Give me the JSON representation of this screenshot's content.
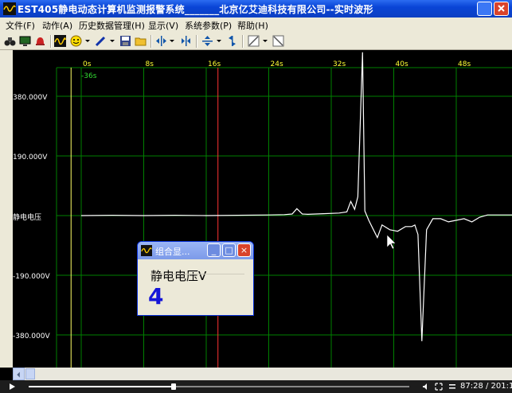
{
  "window": {
    "title": "EST405静电动态计算机监测报警系统_______北京亿艾迪科技有限公司--实时波形",
    "icon": "waveform-app-icon"
  },
  "menu": {
    "items": [
      "文件(F)",
      "动作(A)",
      "历史数据管理(H)",
      "显示(V)",
      "系统参数(P)",
      "帮助(H)"
    ]
  },
  "toolbar": {
    "icons": [
      "binoculars-icon",
      "monitor-icon",
      "alarm-bell-icon",
      "waveform-icon",
      "smiley-icon",
      "pen-icon",
      "save-disk-icon",
      "open-folder-icon",
      "zoom-in-x-icon",
      "zoom-out-x-icon",
      "zoom-in-y-icon",
      "fit-y-icon",
      "line-style-icon",
      "grid-toggle-icon"
    ]
  },
  "chart_data": {
    "type": "line",
    "x_tick_labels": [
      "0s",
      "8s",
      "16s",
      "24s",
      "32s",
      "40s",
      "48s"
    ],
    "x_offset_label": "-36s",
    "y_tick_labels": [
      "380.000V",
      "190.000V",
      "静电电压",
      "-190.000V",
      "-380.000V"
    ],
    "ylim": [
      -380,
      380
    ],
    "series": [
      {
        "name": "静电电压",
        "color": "#ffffff",
        "x": [
          0,
          4,
          8,
          12,
          16,
          20,
          24,
          26,
          27,
          27.6,
          28.3,
          29,
          31,
          33,
          34,
          34.5,
          35,
          35.4,
          36,
          36.3,
          36.8,
          37.3,
          37.9,
          38.5,
          39.5,
          40.5,
          41.5,
          42.3,
          42.7,
          43.1,
          43.6,
          44.2,
          45,
          46,
          47,
          48,
          49,
          50,
          51,
          52,
          55.5
        ],
        "y": [
          0,
          1,
          0,
          1,
          0,
          1,
          2,
          3,
          5,
          22,
          5,
          4,
          6,
          8,
          12,
          45,
          20,
          60,
          520,
          15,
          -15,
          -40,
          -70,
          -30,
          -45,
          -50,
          -35,
          -35,
          -30,
          -60,
          -400,
          -45,
          -10,
          -10,
          -20,
          -15,
          -10,
          -20,
          -5,
          2,
          2
        ]
      }
    ],
    "markers": [
      {
        "name": "yellow-cursor",
        "x": -1.3,
        "color": "#ffff66"
      },
      {
        "name": "red-cursor",
        "x": 17.5,
        "color": "#ff3333"
      }
    ],
    "grid": true
  },
  "dialog": {
    "title": "组合显...",
    "channel_label": "静电电压V",
    "value": "4",
    "buttons": [
      "_",
      "□",
      "×"
    ]
  },
  "statusbar": {
    "time": "87:28 / 201:1",
    "progress": 0.38
  },
  "colors": {
    "grid": "#008000",
    "trace": "#ffffff",
    "xaxis_text": "#ffff33",
    "title_blue": "#0a45d6"
  }
}
